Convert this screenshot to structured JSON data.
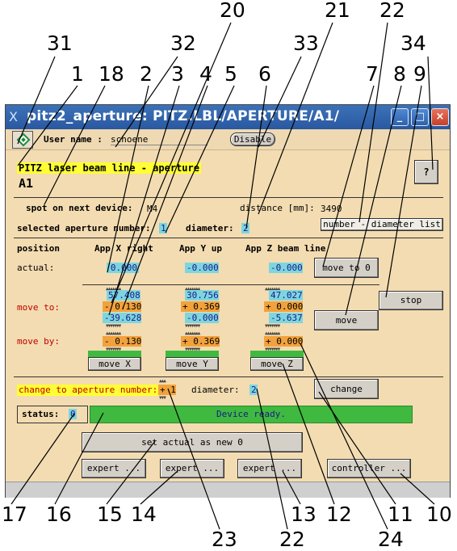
{
  "window": {
    "app_icon": "X",
    "title": "pitz2_aperture: PITZ.LBL/APERTURE/A1/",
    "controls": {
      "minimize": "_",
      "maximize": "□",
      "close": "×"
    }
  },
  "toolbar": {
    "user_label": "User name :",
    "user_value": "schoene",
    "disable_label": "Disable"
  },
  "header": {
    "line_title": "PITZ laser beam line - aperture",
    "device": "A1",
    "help_label": "?"
  },
  "info": {
    "spot_label": "spot on next device:",
    "spot_value": "M4",
    "distance_label": "distance [mm]:",
    "distance_value": "3490",
    "aperture_label": "selected aperture number:",
    "aperture_value": "1",
    "diameter_label": "diameter:",
    "diameter_value": "2",
    "list_button": "number - diameter list"
  },
  "position": {
    "label": "position",
    "col_x": "App X right",
    "col_y": "App Y up",
    "col_z": "App Z beam line",
    "actual_label": "actual:",
    "actual_x": "0.000",
    "actual_y": "-0.000",
    "actual_z": "-0.000",
    "move_to_zero": "move to 0"
  },
  "move_to": {
    "label": "move to:",
    "x_top": "57.408",
    "x_mid": "- 0.130",
    "x_bot": "-39.628",
    "y_top": "30.756",
    "y_mid": "+ 0.369",
    "y_bot": "-0.000",
    "z_top": "47.027",
    "z_mid": "+ 0.000",
    "z_bot": "-5.637",
    "stop": "stop",
    "move": "move"
  },
  "move_by": {
    "label": "move by:",
    "x": "- 0.130",
    "y": "+ 0.369",
    "z": "+ 0.000",
    "move_x": "move X",
    "move_y": "move Y",
    "move_z": "move Z"
  },
  "change": {
    "label": "change to aperture number:",
    "number": "+ 1",
    "diameter_label": "diameter:",
    "diameter_value": "2",
    "button": "change"
  },
  "status": {
    "label": "status:",
    "code": "0",
    "message": "Device ready."
  },
  "actions": {
    "set_actual": "set actual as new 0",
    "expert1": "expert ...",
    "expert2": "expert ...",
    "expert3": "expert ...",
    "controller": "controller ..."
  },
  "callouts": {
    "top": [
      "31",
      "1",
      "18",
      "2",
      "32",
      "3",
      "4",
      "5",
      "20",
      "6",
      "21",
      "33",
      "22",
      "7",
      "8",
      "9",
      "34"
    ],
    "bottom": [
      "17",
      "16",
      "15",
      "14",
      "23",
      "22",
      "13",
      "12",
      "24",
      "11",
      "10"
    ]
  },
  "colors": {
    "panel": "#f3dcb1",
    "title_bar": "#2f62ad",
    "cyan_field": "#7dd6df",
    "orange_field": "#f2a23c",
    "status_green": "#3fb93f",
    "header_highlight": "#ffff33",
    "label_red": "#c00000"
  }
}
